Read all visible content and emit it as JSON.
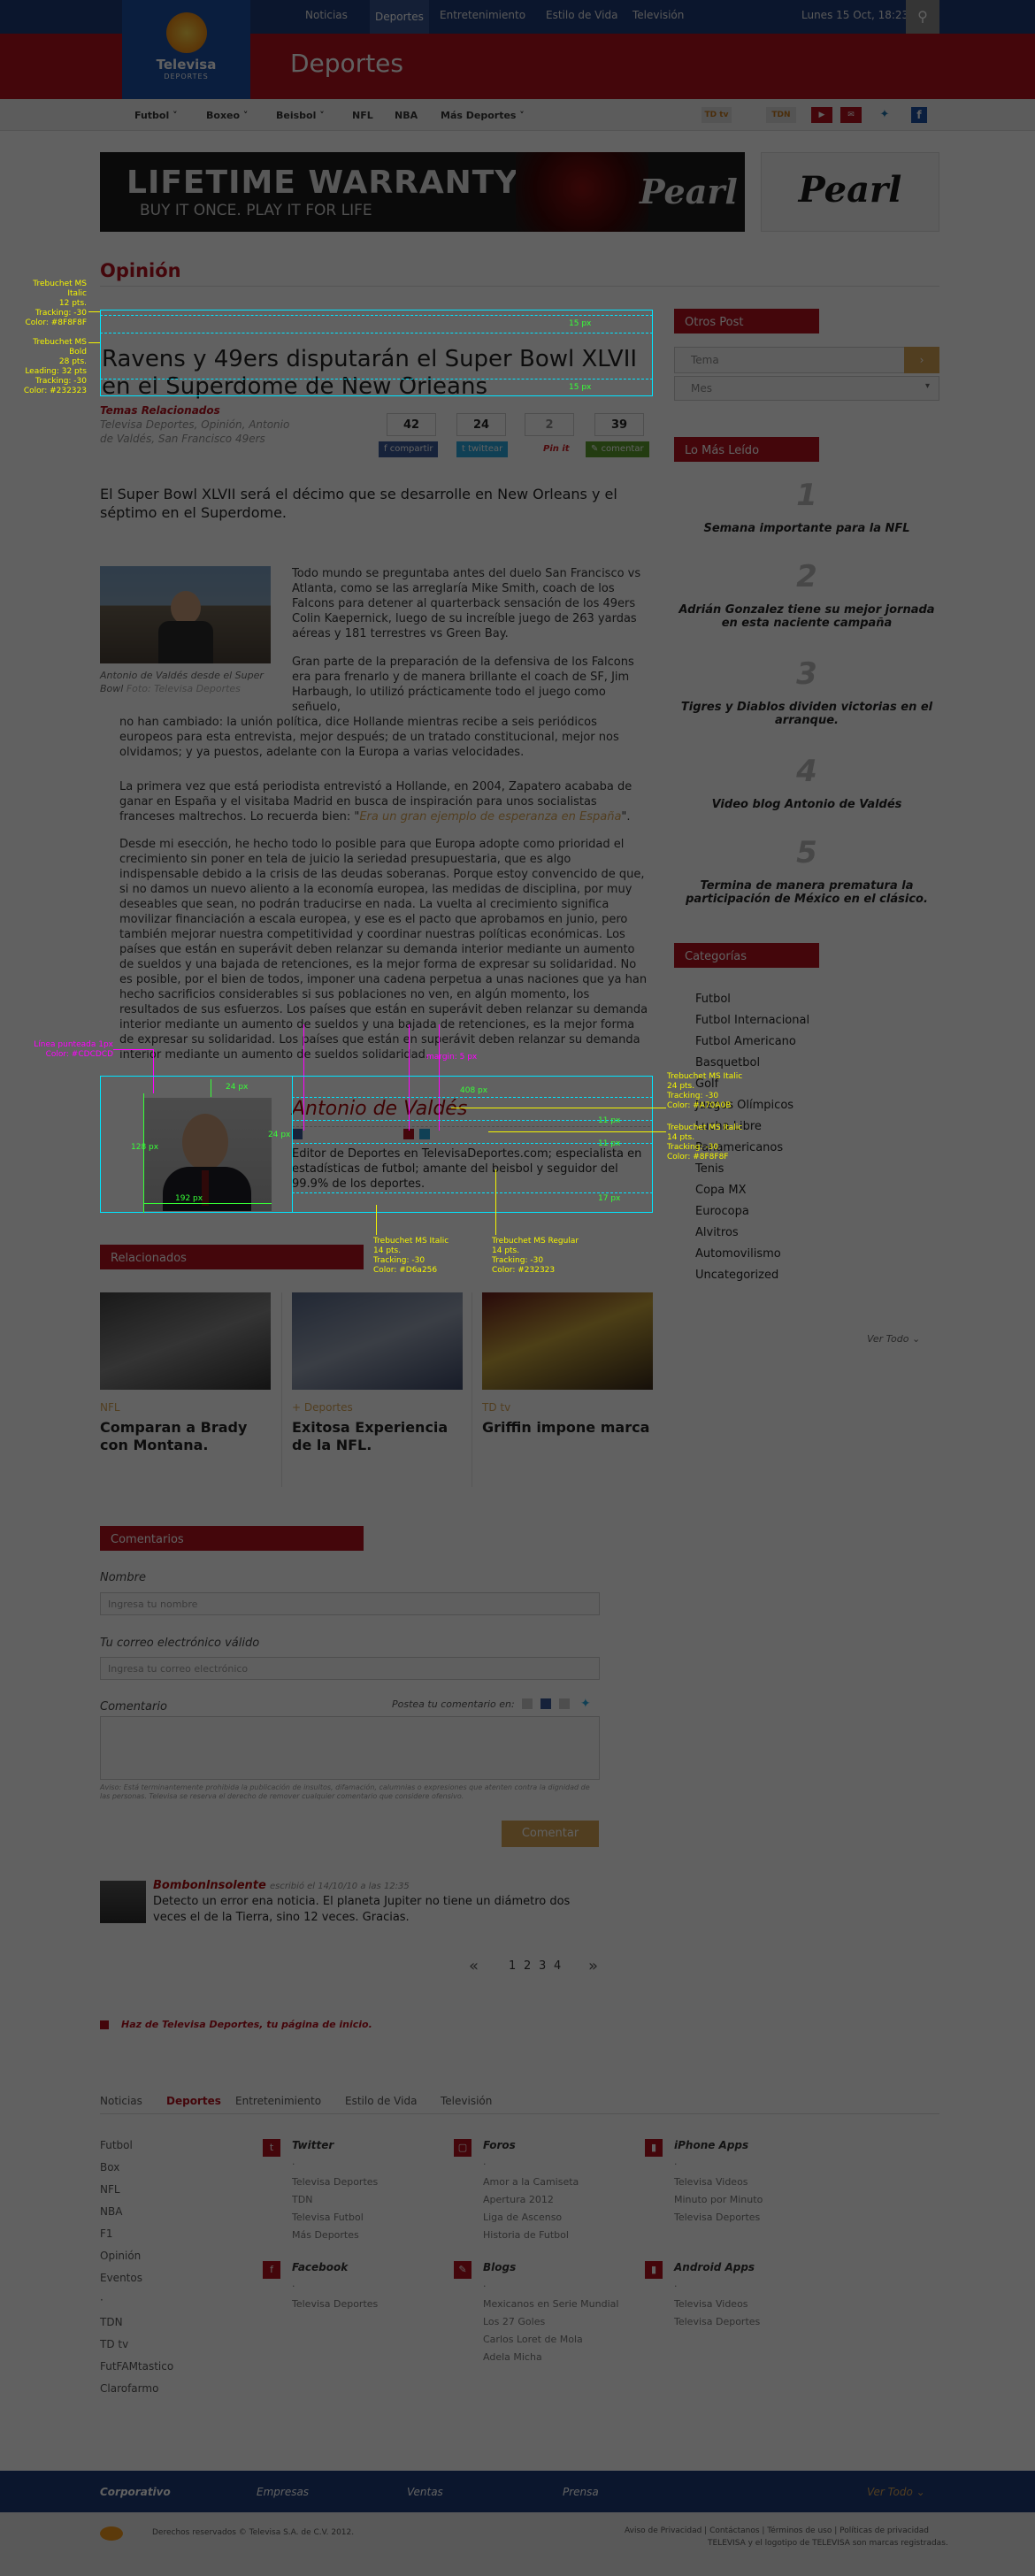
{
  "topnav": {
    "items": [
      "Noticias",
      "Deportes",
      "Entretenimiento",
      "Estilo de Vida",
      "Televisión"
    ],
    "date": "Lunes 15 Oct, 18:23"
  },
  "logo": {
    "brand": "Televisa",
    "sub": "DEPORTES"
  },
  "section_title": "Deportes",
  "subnav": [
    "Futbol",
    "Boxeo",
    "Beisbol",
    "NFL",
    "NBA",
    "Más Deportes"
  ],
  "ad": {
    "headline": "LIFETIME WARRANTY",
    "tagline": "BUY IT ONCE.   PLAY IT FOR LIFE",
    "brand": "Pearl",
    "brand2": "Pearl"
  },
  "category": "Opinión",
  "article": {
    "headline": "Ravens y 49ers disputarán el Super Bowl XLVII en el Superdome de New Orleans",
    "related_topics_label": "Temas Relacionados",
    "related_topics": "Televisa Deportes, Opinión, Antonio de Valdés, San Francisco 49ers",
    "stats": [
      "42",
      "24",
      "2",
      "39"
    ],
    "share": [
      "compartir",
      "twittear",
      "Pin it",
      "comentar"
    ],
    "lead": "El Super Bowl XLVII será el décimo que se desarrolle en New Orleans y el séptimo en el Superdome.",
    "caption": "Antonio de Valdés desde el Super Bowl",
    "photo_credit": "Foto: Televisa Deportes",
    "p1": "Todo mundo se preguntaba antes del duelo San Francisco vs Atlanta, como se las arreglaría Mike Smith, coach de los Falcons para detener al quarterback sensación de los 49ers Colin Kaepernick, luego de su increíble juego de 263 yardas aéreas y 181 terrestres vs Green Bay.",
    "p2": "Gran parte de la preparación de la defensiva de los Falcons era para frenarlo y de manera brillante el coach de SF, Jim Harbaugh, lo utilizó prácticamente todo el juego como señuelo,",
    "p3": "no han cambiado: la unión política, dice Hollande mientras recibe a seis periódicos europeos para esta entrevista, mejor después; de un tratado constitucional, mejor nos olvidamos; y ya puestos, adelante con la Europa a varias velocidades.",
    "p4a": "La primera vez que está periodista entrevistó a Hollande, en 2004, Zapatero acababa de ganar en España y el visitaba Madrid en busca de inspiración para unos socialistas franceses maltrechos. Lo recuerda bien: \"",
    "p4link": "Era un gran ejemplo de esperanza en España",
    "p4b": "\".",
    "p5": "Desde mi esección, he hecho todo lo posible para que Europa adopte como prioridad el crecimiento sin poner en tela de juicio la seriedad presupuestaria, que es algo indispensable debido a la crisis de las deudas soberanas. Porque estoy convencido de que, si no damos un nuevo aliento a la economía europea, las medidas de disciplina, por muy deseables que sean, no podrán traducirse en nada. La vuelta al crecimiento significa movilizar financiación a escala europea, y ese es el pacto que aprobamos en junio, pero también mejorar nuestra competitividad y coordinar nuestras políticas económicas. Los países que están en superávit deben relanzar su demanda interior mediante un aumento de sueldos y una bajada de retenciones, es la mejor forma de expresar su solidaridad. No es posible, por el bien de todos, imponer una cadena perpetua a unas naciones que ya han hecho sacrificios considerables si sus poblaciones no ven, en algún momento, los resultados de sus esfuerzos.  Los países que están en superávit deben relanzar su demanda interior mediante un aumento de sueldos y una bajada de retenciones, es la mejor forma de expresar su solidaridad.  Los países que están en superávit deben relanzar su demanda interior mediante un aumento de sueldos solidaridad."
  },
  "author": {
    "name": "Antonio de Valdés",
    "bio": "Editor de Deportes en TelevisaDeportes.com; especialista en estadísticas de futbol; amante del beisbol y seguidor del 99.9% de los deportes."
  },
  "related": {
    "title": "Relacionados",
    "items": [
      {
        "cat": "NFL",
        "title": "Comparan a Brady con Montana."
      },
      {
        "cat": "+ Deportes",
        "title": "Exitosa Experiencia de la NFL."
      },
      {
        "cat": "TD tv",
        "title": "Griffin impone marca"
      }
    ]
  },
  "comments": {
    "title": "Comentarios",
    "name_label": "Nombre",
    "name_placeholder": "Ingresa tu nombre",
    "email_label": "Tu correo electrónico válido",
    "email_placeholder": "Ingresa tu correo electrónico",
    "comment_label": "Comentario",
    "post_in": "Postea tu comentario en:",
    "disclaimer": "Aviso: Está terminantemente prohibida la publicación de insultos, difamación, calumnias o expresiones que atenten contra la dignidad de las personas. Televisa se reserva el derecho de remover cualquier comentario que considere ofensivo.",
    "submit": "Comentar",
    "sample": {
      "user": "Bombonlnsolente",
      "meta": "escribió el 14/10/10 a las 12:35",
      "text": "Detecto un error ena noticia. El planeta Jupiter no tiene un diámetro dos veces el de la Tierra, sino 12 veces. Gracias."
    },
    "pages": [
      "«",
      "1",
      "2",
      "3",
      "4",
      "»"
    ]
  },
  "make_home": "Haz de Televisa Deportes, tu página de inicio.",
  "sidebar": {
    "otros": "Otros Post",
    "sel1": "Tema",
    "sel2": "Mes",
    "mas_leido": "Lo Más Leído",
    "ranks": [
      {
        "n": "1",
        "t": "Semana importante para la NFL"
      },
      {
        "n": "2",
        "t": "Adrián Gonzalez tiene su mejor jornada en esta naciente campaña"
      },
      {
        "n": "3",
        "t": "Tigres y Diablos dividen victorias en el arranque."
      },
      {
        "n": "4",
        "t": "Video blog Antonio de Valdés"
      },
      {
        "n": "5",
        "t": "Termina de manera prematura la participación de México en el clásico."
      }
    ],
    "categorias": "Categorías",
    "cats": [
      "Futbol",
      "Futbol Internacional",
      "Futbol Americano",
      "Basquetbol",
      "Golf",
      "Juegos Olímpicos",
      "Lucha Libre",
      "Panamericanos",
      "Tenis",
      "Copa MX",
      "Eurocopa",
      "Alvitros",
      "Automovilismo",
      "Uncategorized"
    ],
    "ver_todo": "Ver Todo"
  },
  "footer": {
    "nav": [
      "Noticias",
      "Deportes",
      "Entretenimiento",
      "Estilo de Vida",
      "Televisión"
    ],
    "left": [
      "Futbol",
      "Box",
      "NFL",
      "NBA",
      "F1",
      "Opinión",
      "Eventos",
      "·",
      "TDN",
      "TD tv",
      "FutFAMtastico",
      "Clarofarmo"
    ],
    "twitter": {
      "h": "Twitter",
      "items": [
        "·",
        "Televisa Deportes",
        "TDN",
        "Televisa Futbol",
        "Más Deportes"
      ]
    },
    "foros": {
      "h": "Foros",
      "items": [
        "·",
        "Amor a la Camiseta",
        "Apertura 2012",
        "Liga de Ascenso",
        "Historia de Futbol"
      ]
    },
    "iphone": {
      "h": "iPhone Apps",
      "items": [
        "·",
        "Televisa Videos",
        "Minuto por Minuto",
        "Televisa Deportes"
      ]
    },
    "facebook": {
      "h": "Facebook",
      "items": [
        "·",
        "Televisa Deportes"
      ]
    },
    "blogs": {
      "h": "Blogs",
      "items": [
        "·",
        "Mexicanos en Serie Mundial",
        "Los 27 Goles",
        "Carlos Loret de Mola",
        "Adela Micha"
      ]
    },
    "android": {
      "h": "Android Apps",
      "items": [
        "·",
        "Televisa Videos",
        "Televisa Deportes"
      ]
    },
    "bottom": [
      "Corporativo",
      "Empresas",
      "Ventas",
      "Prensa"
    ],
    "ver_todo": "Ver Todo",
    "copyright": "Derechos reservados © Televisa S.A. de C.V. 2012.",
    "links": "Aviso de Privacidad  |  Contáctanos  |  Términos de uso  |  Políticas de privacidad",
    "legal": "TELEVISA y el logotipo de TELEVISA son marcas registradas."
  },
  "annotations": {
    "s1": "Trebuchet MS Italic\n12 pts.\nTracking: -30\nColor: #8F8F8F",
    "s2": "Trebuchet MS Bold\n28 pts.\nLeading: 32 pts\nTracking: -30\nColor: #232323",
    "gap15": "15 px",
    "gap24": "24 px",
    "gap408": "408 px",
    "gap128": "128 px",
    "gap192": "192 px",
    "gap11": "11 px",
    "gap17": "17 px",
    "s3": "Línea punteada 1px\nColor: #CDCDCD",
    "margin": "margin: 5 px",
    "s4": "Trebuchet MS Italic\n24 pts.\nTracking: -30\nColor: #A70A0B",
    "s5": "Trebuchet MS Italic\n14 pts.\nTracking: -30\nColor: #8F8F8F",
    "s6": "Trebuchet MS Italic\n14 pts.\nTracking: -30\nColor: #D6a256",
    "s7": "Trebuchet MS Regular\n14 pts.\nTracking: -30\nColor: #232323"
  }
}
